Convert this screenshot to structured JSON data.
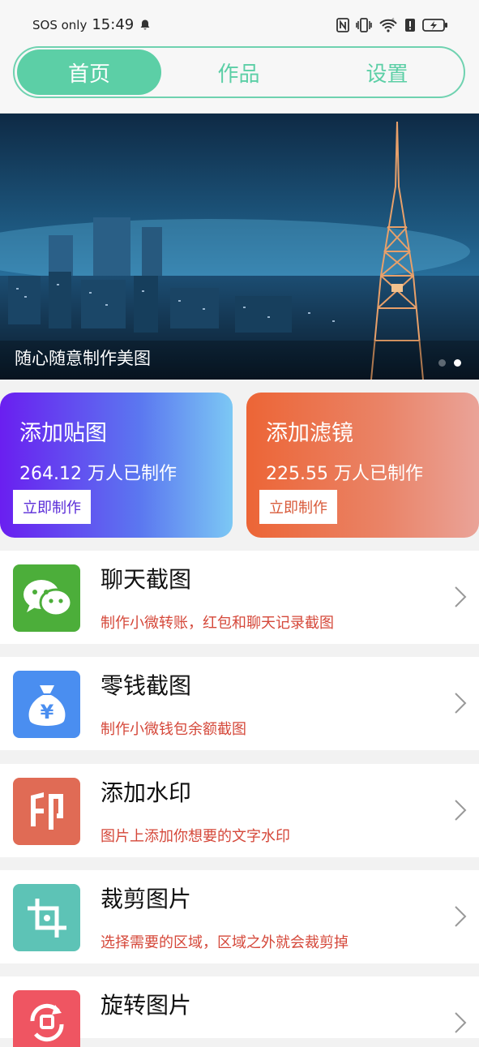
{
  "status_bar": {
    "carrier": "SOS only",
    "time": "15:49"
  },
  "tabs": [
    {
      "label": "首页",
      "active": true
    },
    {
      "label": "作品",
      "active": false
    },
    {
      "label": "设置",
      "active": false
    }
  ],
  "banner": {
    "caption": "随心随意制作美图",
    "slides": 2,
    "active_slide": 2
  },
  "cards": [
    {
      "title": "添加贴图",
      "count": "264.12 万人已制作",
      "button": "立即制作"
    },
    {
      "title": "添加滤镜",
      "count": "225.55 万人已制作",
      "button": "立即制作"
    }
  ],
  "features": [
    {
      "title": "聊天截图",
      "desc": "制作小微转账，红包和聊天记录截图",
      "icon": "chat-bubbles-icon",
      "color": "#4cae3a"
    },
    {
      "title": "零钱截图",
      "desc": "制作小微钱包余额截图",
      "icon": "money-bag-icon",
      "color": "#4a8ef0"
    },
    {
      "title": "添加水印",
      "desc": "图片上添加你想要的文字水印",
      "icon": "seal-yin-icon",
      "color": "#e06b55"
    },
    {
      "title": "裁剪图片",
      "desc": "选择需要的区域，区域之外就会裁剪掉",
      "icon": "crop-icon",
      "color": "#5dc3b6"
    },
    {
      "title": "旋转图片",
      "desc": "",
      "icon": "rotate-icon",
      "color": "#ef5562"
    }
  ],
  "colors": {
    "accent": "#5ccfa6",
    "desc_red": "#d5483a"
  }
}
